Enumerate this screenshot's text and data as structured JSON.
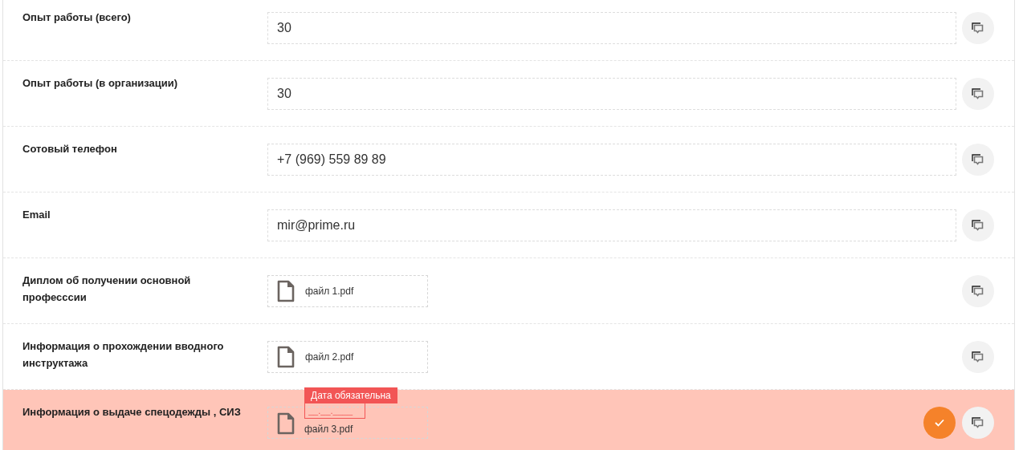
{
  "rows": [
    {
      "label": "Опыт работы (всего)",
      "kind": "text",
      "value": "30",
      "invalid": false
    },
    {
      "label": "Опыт работы (в организации)",
      "kind": "text",
      "value": "30",
      "invalid": false
    },
    {
      "label": "Сотовый телефон",
      "kind": "text",
      "value": "+7 (969) 559 89 89",
      "invalid": false
    },
    {
      "label": "Email",
      "kind": "text",
      "value": "mir@prime.ru",
      "invalid": false
    },
    {
      "label": "Диплом об получении основной професссии",
      "kind": "file",
      "file": "файл 1.pdf",
      "invalid": false
    },
    {
      "label": "Информация о прохождении вводного инструктажа",
      "kind": "file",
      "file": "файл 2.pdf",
      "invalid": false
    },
    {
      "label": "Информация о выдаче спецодежды , СИЗ",
      "kind": "file",
      "file": "файл 3.pdf",
      "invalid": true,
      "error": "Дата обязательна",
      "date": {
        "placeholder": "__.__.____"
      },
      "confirm_button": true
    }
  ]
}
